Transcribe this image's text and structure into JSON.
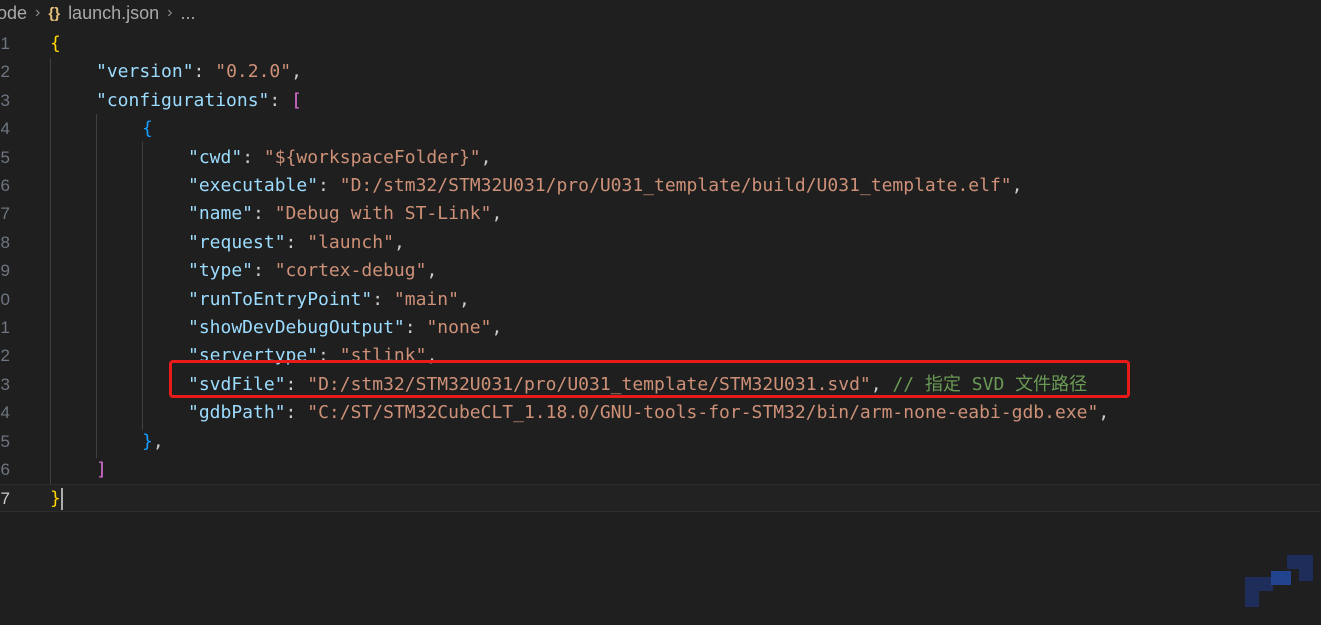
{
  "breadcrumb": {
    "root": "ode",
    "file": "launch.json",
    "more": "..."
  },
  "icons": {
    "json": "{}",
    "chevron": "›"
  },
  "lines": [
    {
      "n": "1",
      "indent": 0,
      "tokens": [
        {
          "t": "{",
          "c": "b1"
        }
      ]
    },
    {
      "n": "2",
      "indent": 1,
      "tokens": [
        {
          "t": "\"version\"",
          "c": "k"
        },
        {
          "t": ": ",
          "c": "p"
        },
        {
          "t": "\"0.2.0\"",
          "c": "s"
        },
        {
          "t": ",",
          "c": "p"
        }
      ]
    },
    {
      "n": "3",
      "indent": 1,
      "tokens": [
        {
          "t": "\"configurations\"",
          "c": "k"
        },
        {
          "t": ": ",
          "c": "p"
        },
        {
          "t": "[",
          "c": "b2"
        }
      ]
    },
    {
      "n": "4",
      "indent": 2,
      "tokens": [
        {
          "t": "{",
          "c": "b3"
        }
      ]
    },
    {
      "n": "5",
      "indent": 3,
      "tokens": [
        {
          "t": "\"cwd\"",
          "c": "k"
        },
        {
          "t": ": ",
          "c": "p"
        },
        {
          "t": "\"${workspaceFolder}\"",
          "c": "s"
        },
        {
          "t": ",",
          "c": "p"
        }
      ]
    },
    {
      "n": "6",
      "indent": 3,
      "tokens": [
        {
          "t": "\"executable\"",
          "c": "k"
        },
        {
          "t": ": ",
          "c": "p"
        },
        {
          "t": "\"D:/stm32/STM32U031/pro/U031_template/build/U031_template.elf\"",
          "c": "s"
        },
        {
          "t": ",",
          "c": "p"
        }
      ]
    },
    {
      "n": "7",
      "indent": 3,
      "tokens": [
        {
          "t": "\"name\"",
          "c": "k"
        },
        {
          "t": ": ",
          "c": "p"
        },
        {
          "t": "\"Debug with ST-Link\"",
          "c": "s"
        },
        {
          "t": ",",
          "c": "p"
        }
      ]
    },
    {
      "n": "8",
      "indent": 3,
      "tokens": [
        {
          "t": "\"request\"",
          "c": "k"
        },
        {
          "t": ": ",
          "c": "p"
        },
        {
          "t": "\"launch\"",
          "c": "s"
        },
        {
          "t": ",",
          "c": "p"
        }
      ]
    },
    {
      "n": "9",
      "indent": 3,
      "tokens": [
        {
          "t": "\"type\"",
          "c": "k"
        },
        {
          "t": ": ",
          "c": "p"
        },
        {
          "t": "\"cortex-debug\"",
          "c": "s"
        },
        {
          "t": ",",
          "c": "p"
        }
      ]
    },
    {
      "n": "0",
      "indent": 3,
      "tokens": [
        {
          "t": "\"runToEntryPoint\"",
          "c": "k"
        },
        {
          "t": ": ",
          "c": "p"
        },
        {
          "t": "\"main\"",
          "c": "s"
        },
        {
          "t": ",",
          "c": "p"
        }
      ]
    },
    {
      "n": "1",
      "indent": 3,
      "tokens": [
        {
          "t": "\"showDevDebugOutput\"",
          "c": "k"
        },
        {
          "t": ": ",
          "c": "p"
        },
        {
          "t": "\"none\"",
          "c": "s"
        },
        {
          "t": ",",
          "c": "p"
        }
      ]
    },
    {
      "n": "2",
      "indent": 3,
      "tokens": [
        {
          "t": "\"servertype\"",
          "c": "k"
        },
        {
          "t": ": ",
          "c": "p"
        },
        {
          "t": "\"stlink\"",
          "c": "s"
        },
        {
          "t": ",",
          "c": "p"
        }
      ]
    },
    {
      "n": "3",
      "indent": 3,
      "tokens": [
        {
          "t": "\"svdFile\"",
          "c": "k"
        },
        {
          "t": ": ",
          "c": "p"
        },
        {
          "t": "\"D:/stm32/STM32U031/pro/U031_template/STM32U031.svd\"",
          "c": "s"
        },
        {
          "t": ", ",
          "c": "p"
        },
        {
          "t": "// 指定 SVD 文件路径",
          "c": "c"
        }
      ]
    },
    {
      "n": "4",
      "indent": 3,
      "tokens": [
        {
          "t": "\"gdbPath\"",
          "c": "k"
        },
        {
          "t": ": ",
          "c": "p"
        },
        {
          "t": "\"C:/ST/STM32CubeCLT_1.18.0/GNU-tools-for-STM32/bin/arm-none-eabi-gdb.exe\"",
          "c": "s"
        },
        {
          "t": ",",
          "c": "p"
        }
      ]
    },
    {
      "n": "5",
      "indent": 2,
      "tokens": [
        {
          "t": "}",
          "c": "b3"
        },
        {
          "t": ",",
          "c": "p"
        }
      ]
    },
    {
      "n": "6",
      "indent": 1,
      "tokens": [
        {
          "t": "]",
          "c": "b2"
        }
      ]
    },
    {
      "n": "7",
      "indent": 0,
      "current": true,
      "tokens": [
        {
          "t": "}",
          "c": "b1"
        }
      ]
    }
  ],
  "colors": {
    "background": "#1f1f1f",
    "key": "#9cdcfe",
    "string": "#ce9178",
    "comment": "#6a9955",
    "highlight_box": "#e81a1a"
  }
}
